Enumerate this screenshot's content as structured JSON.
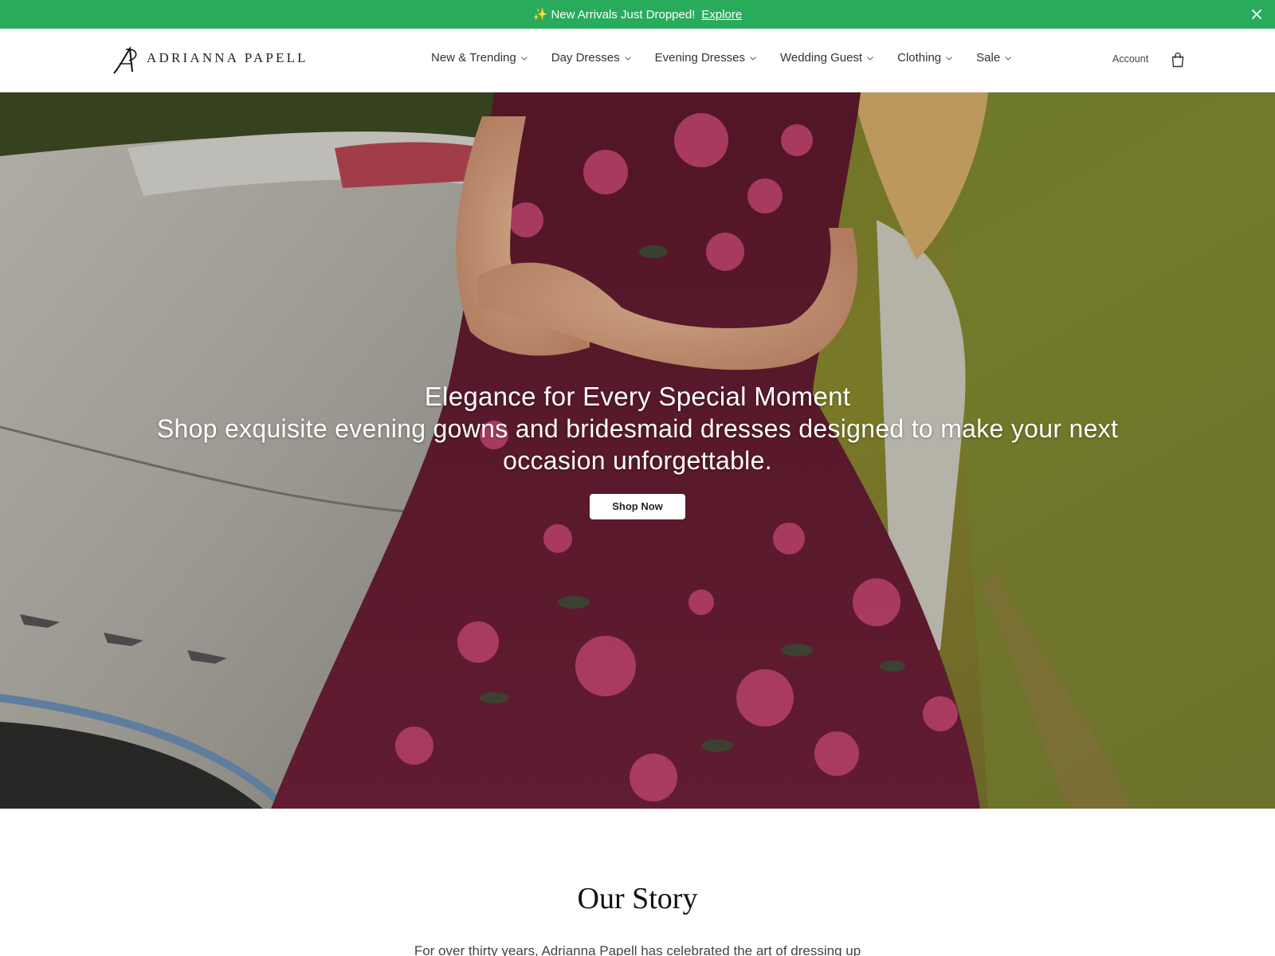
{
  "announcement": {
    "message": "New Arrivals Just Dropped!",
    "link": "Explore",
    "bg_color": "#29ab5c",
    "icons": [
      "sparkle-icon",
      "close-icon"
    ]
  },
  "header": {
    "logo_text": "ADRIANNA PAPELL",
    "nav": [
      {
        "label": "New & Trending"
      },
      {
        "label": "Day Dresses"
      },
      {
        "label": "Evening Dresses"
      },
      {
        "label": "Wedding Guest"
      },
      {
        "label": "Clothing"
      },
      {
        "label": "Sale"
      }
    ],
    "account_label": "Account",
    "icons": [
      "chevron-down-icon",
      "shopping-bag-icon"
    ]
  },
  "hero": {
    "title": "Elegance for Every Special Moment",
    "subtitle": "Shop exquisite evening gowns and bridesmaid dresses designed to make your next occasion unforgettable.",
    "cta_label": "Shop Now"
  },
  "story": {
    "title": "Our Story",
    "text": "For over thirty years, Adrianna Papell has celebrated the art of dressing up"
  }
}
